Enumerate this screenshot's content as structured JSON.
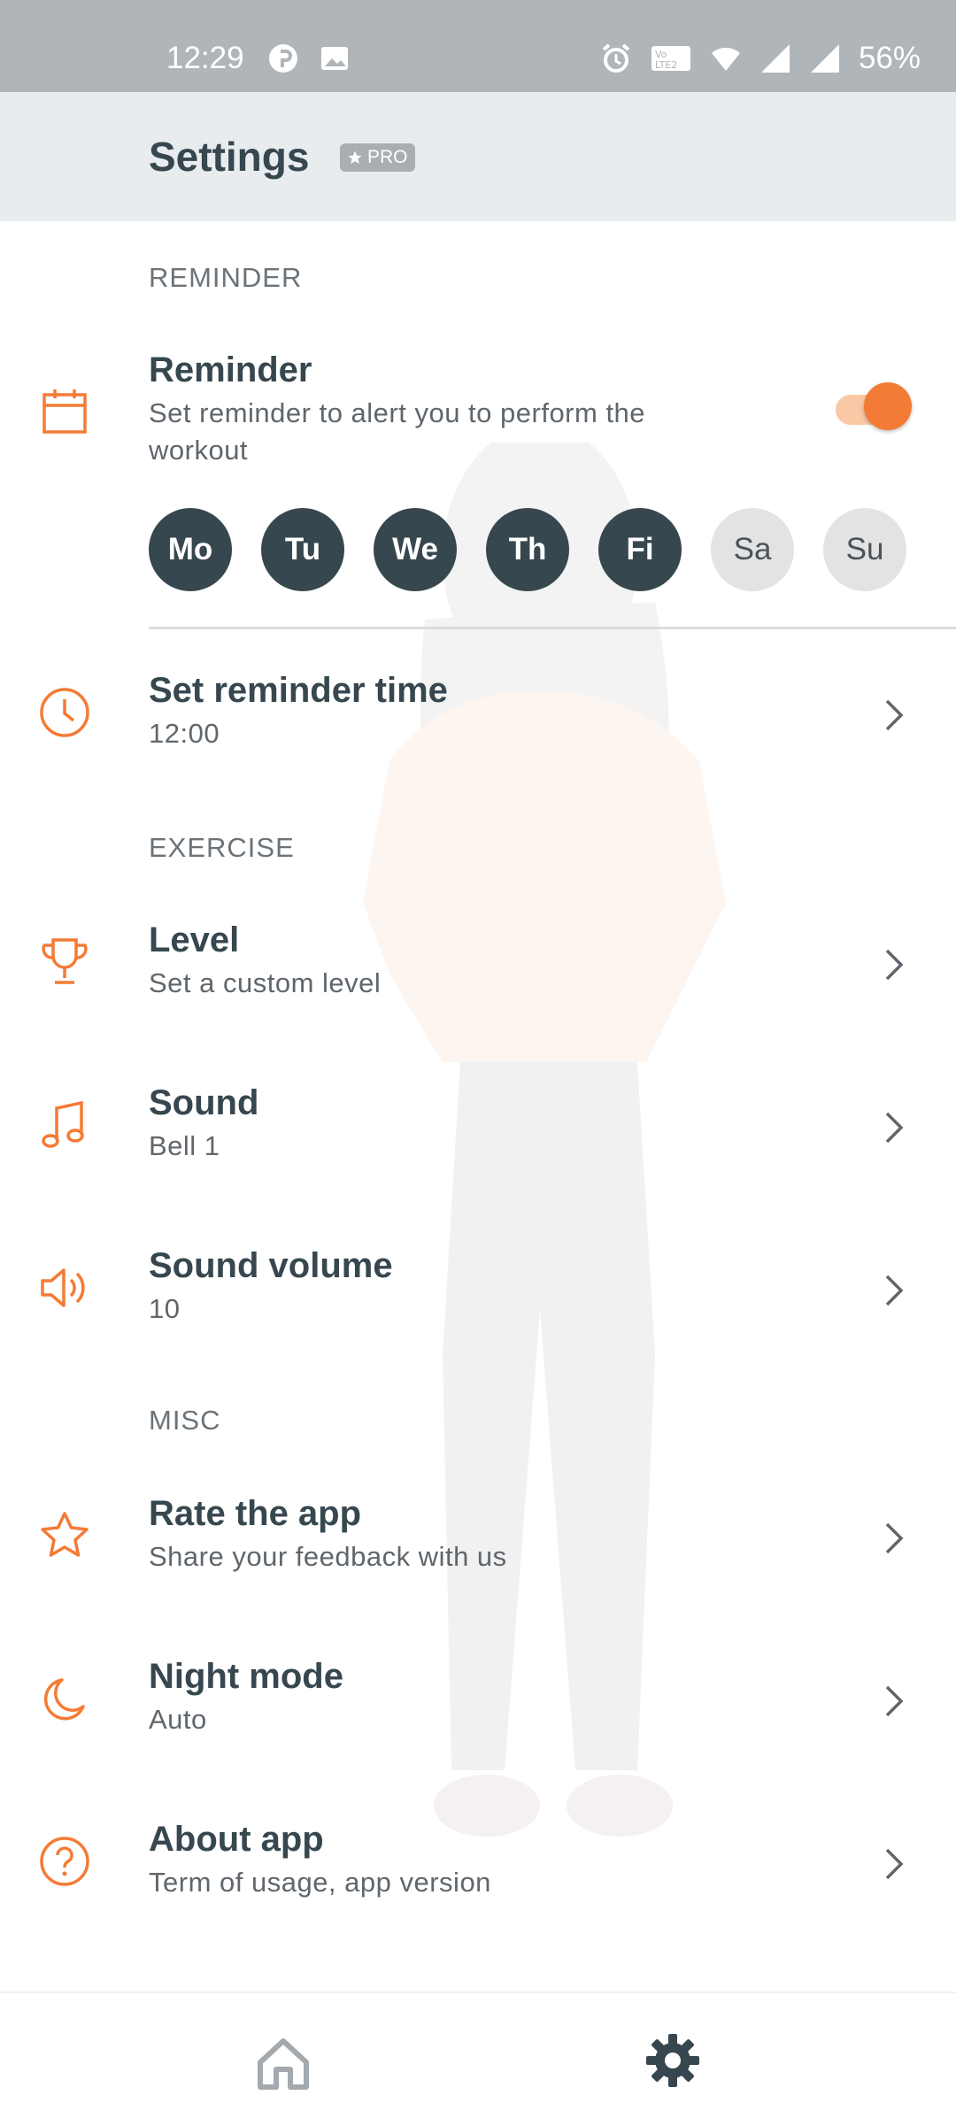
{
  "status_bar": {
    "time": "12:29",
    "battery": "56%",
    "icons": [
      "pinterest-icon",
      "image-icon",
      "alarm-icon",
      "volte-icon",
      "wifi-icon",
      "signal-icon",
      "signal-icon",
      "battery"
    ]
  },
  "header": {
    "title": "Settings",
    "badge": "PRO"
  },
  "sections": {
    "reminder": "REMINDER",
    "exercise": "EXERCISE",
    "misc": "MISC"
  },
  "reminder": {
    "title": "Reminder",
    "subtitle": "Set reminder to alert you to perform the",
    "subtitle_line2": "workout",
    "toggle_on": true,
    "days": [
      {
        "label": "Mo",
        "active": true
      },
      {
        "label": "Tu",
        "active": true
      },
      {
        "label": "We",
        "active": true
      },
      {
        "label": "Th",
        "active": true
      },
      {
        "label": "Fi",
        "active": true
      },
      {
        "label": "Sa",
        "active": false
      },
      {
        "label": "Su",
        "active": false
      }
    ]
  },
  "reminder_time": {
    "title": "Set reminder time",
    "value": "12:00"
  },
  "level": {
    "title": "Level",
    "subtitle": "Set a custom level"
  },
  "sound": {
    "title": "Sound",
    "value": "Bell 1"
  },
  "sound_volume": {
    "title": "Sound volume",
    "value": "10"
  },
  "rate": {
    "title": "Rate the app",
    "subtitle": "Share your feedback with us"
  },
  "night_mode": {
    "title": "Night mode",
    "value": "Auto"
  },
  "about": {
    "title": "About app",
    "subtitle": "Term of usage, app version"
  },
  "colors": {
    "accent": "#f47b35",
    "text_dark": "#37474f",
    "header_bg": "#e8ecef",
    "status_bar": "#b0b5b9"
  }
}
